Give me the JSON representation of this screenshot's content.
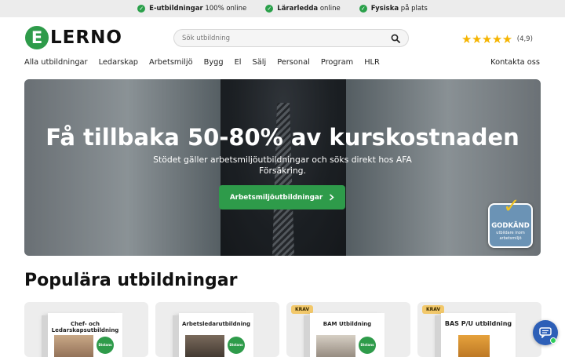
{
  "topbar": {
    "usps": [
      {
        "strong": "E-utbildningar",
        "rest": "100% online"
      },
      {
        "strong": "Lärarledda",
        "rest": "online"
      },
      {
        "strong": "Fysiska",
        "rest": "på plats"
      }
    ]
  },
  "header": {
    "logo_letter": "E",
    "logo_word": "LERNO",
    "search_placeholder": "Sök utbildning",
    "stars": "★★★★★",
    "rating": "(4,9)"
  },
  "nav": {
    "items": [
      "Alla utbildningar",
      "Ledarskap",
      "Arbetsmiljö",
      "Bygg",
      "El",
      "Sälj",
      "Personal",
      "Program",
      "HLR"
    ],
    "contact": "Kontakta oss"
  },
  "hero": {
    "title": "Få tillbaka 50-80% av kurskostnaden",
    "subtitle_line1": "Stödet gäller arbetsmiljöutbildningar och söks direkt hos AFA",
    "subtitle_line2": "Försäkring.",
    "cta_label": "Arbetsmiljöutbildningar",
    "badge_title": "GODKÄND",
    "badge_sub": "utbildare inom arbetsmiljö"
  },
  "section": {
    "title": "Populära utbildningar"
  },
  "cards": [
    {
      "title": "Chef- och Ledarskapsutbildning",
      "stamp": "Distans",
      "krav": ""
    },
    {
      "title": "Arbetsledarutbildning",
      "stamp": "Distans",
      "krav": ""
    },
    {
      "title": "BAM Utbildning",
      "stamp": "Distans",
      "krav": "KRAV"
    },
    {
      "title": "BAS P/U utbildning",
      "stamp": "",
      "krav": "KRAV"
    }
  ],
  "colors": {
    "brand_green": "#2e9b4a",
    "star": "#f5b400",
    "chat": "#2d5fb7"
  },
  "icons": [
    "check-icon",
    "search-icon",
    "chevron-right-icon",
    "chat-icon"
  ]
}
